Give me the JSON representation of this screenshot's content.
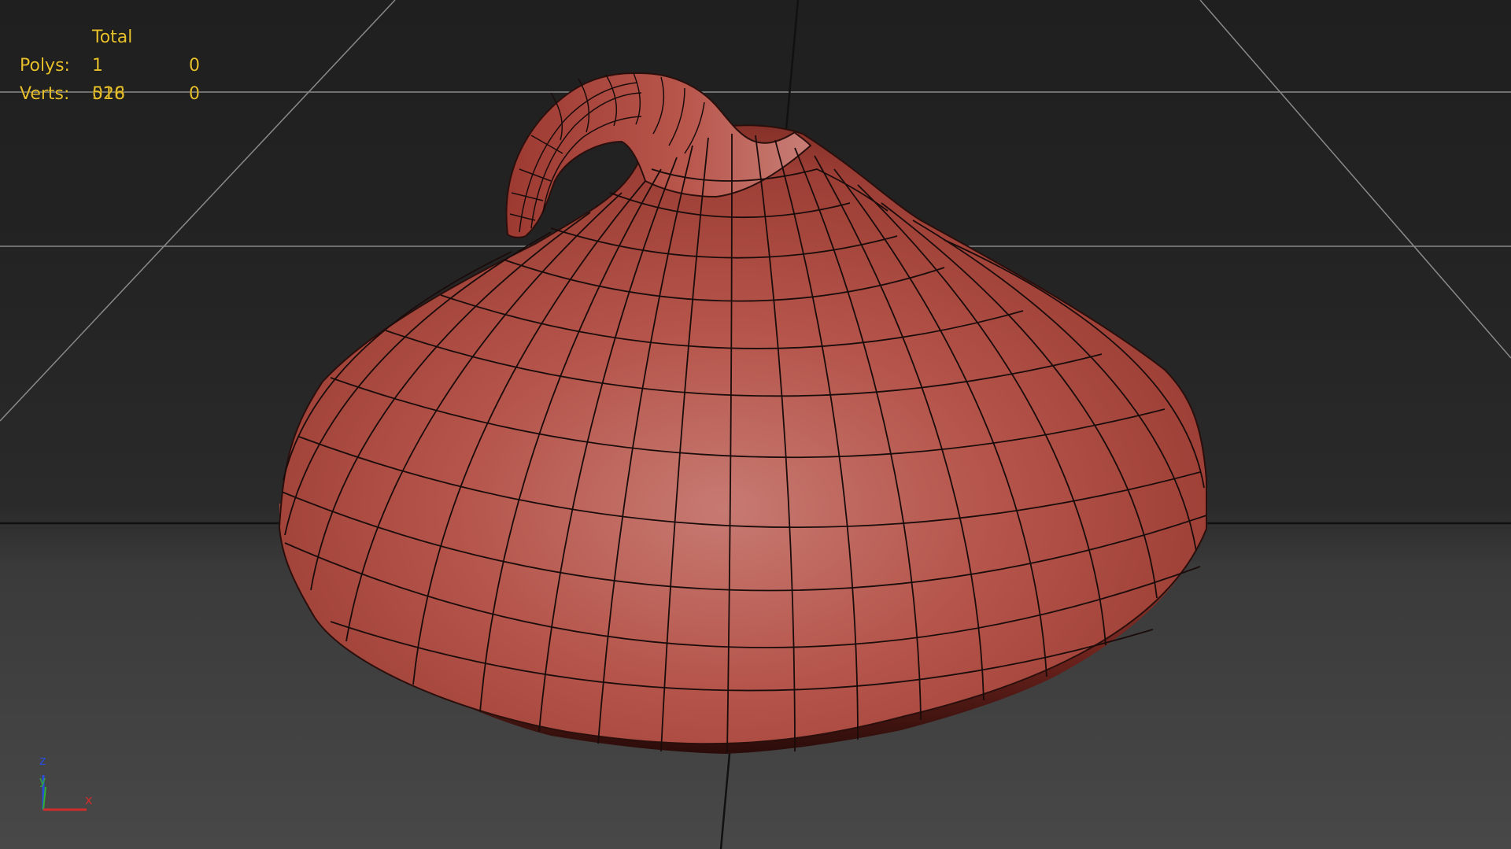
{
  "viewport": {
    "stats": {
      "header": "Total",
      "rows": [
        {
          "label": "Polys:",
          "total": "1 028",
          "selected": "0"
        },
        {
          "label": "Verts:",
          "total": "516",
          "selected": "0"
        }
      ]
    },
    "axis": {
      "z": "z",
      "y": "y",
      "x": "x"
    },
    "colors": {
      "stats_text": "#e7c02d",
      "mesh": "#b14c44",
      "wire": "#1a0c0b",
      "grid": "#8a8a8a",
      "axis_x": "#d12c2c",
      "axis_y": "#2fb02f",
      "axis_z": "#2a4fd6"
    }
  }
}
